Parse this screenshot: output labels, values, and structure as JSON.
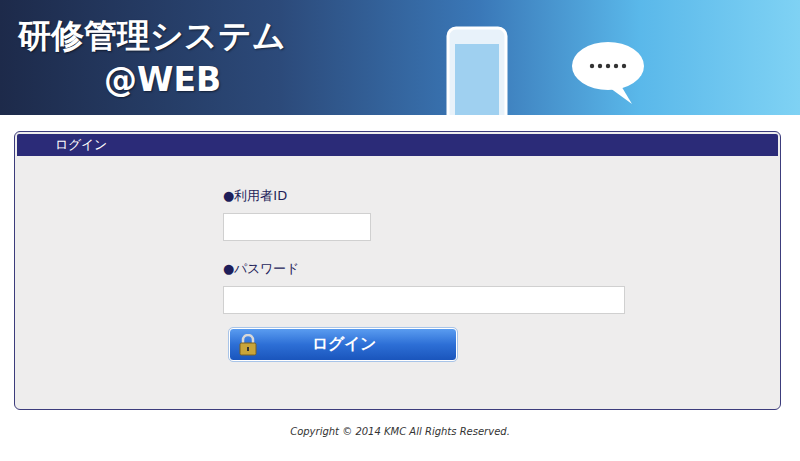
{
  "header": {
    "title": "研修管理システム",
    "subtitle": "@WEB"
  },
  "panel": {
    "title": "ログイン"
  },
  "fields": [
    {
      "label": "●利用者ID",
      "value": "",
      "kind": "id"
    },
    {
      "label": "●パスワード",
      "value": "",
      "kind": "password"
    }
  ],
  "button": {
    "label": "ログイン"
  },
  "footer": {
    "text": "Copyright © 2014 KMC All Rights Reserved."
  }
}
